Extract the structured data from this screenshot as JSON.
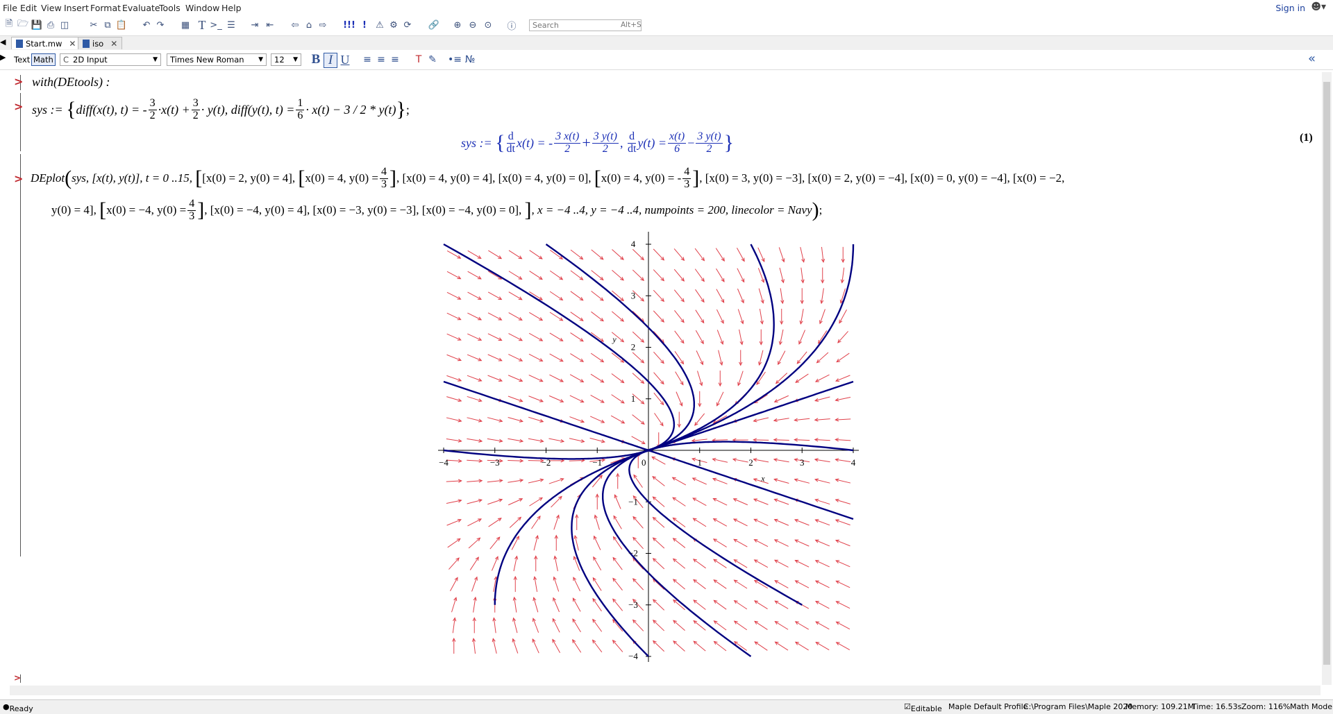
{
  "menu": [
    "File",
    "Edit",
    "View",
    "Insert",
    "Format",
    "Evaluate",
    "Tools",
    "Window",
    "Help"
  ],
  "signin": "Sign in",
  "search": {
    "placeholder": "Search",
    "hint": "Alt+S"
  },
  "tabs": [
    {
      "label": "Start.mw"
    },
    {
      "label": "iso"
    }
  ],
  "context": {
    "text_mode": "Text",
    "math_mode": "Math",
    "input_style": "2D Input",
    "font": "Times New Roman",
    "size": "12",
    "bold": "B",
    "italic": "I",
    "underline": "U"
  },
  "worksheet": {
    "line1": "with(DEtools) :",
    "line2": {
      "lhs": "sys :=",
      "part1": "diff(x(t), t) = -",
      "f1_num": "3",
      "f1_den": "2",
      "part2": "·x(t) +",
      "f2_num": "3",
      "f2_den": "2",
      "part3": "· y(t), diff(y(t), t) =",
      "f3_num": "1",
      "f3_den": "6",
      "part4": "· x(t) − 3 / 2 * y(t)",
      "end": ";"
    },
    "output": {
      "lhs": "sys :=",
      "d1_num": "d",
      "d1_den": "dt",
      "x": "x(t) = -",
      "o1_num": "3 x(t)",
      "o1_den": "2",
      "plus": "+",
      "o2_num": "3 y(t)",
      "o2_den": "2",
      "comma": ",",
      "d2_num": "d",
      "d2_den": "dt",
      "y": "y(t) =",
      "o3_num": "x(t)",
      "o3_den": "6",
      "minus": "−",
      "o4_num": "3 y(t)",
      "o4_den": "2",
      "label": "(1)"
    },
    "deplot": {
      "row1a": "DEplot",
      "row1b": "sys, [x(t), y(t)], t = 0 ..15,",
      "row1c": "[x(0) = 2, y(0) = 4],",
      "row1d": "x(0) = 4, y(0) =",
      "f1_num": "4",
      "f1_den": "3",
      "row1e": ", [x(0) = 4, y(0) = 4], [x(0) = 4, y(0) = 0],",
      "row1f": "x(0) = 4, y(0) = -",
      "f2_num": "4",
      "f2_den": "3",
      "row1g": ", [x(0) = 3, y(0) = −3], [x(0) = 2, y(0) = −4], [x(0) = 0, y(0) = −4], [x(0) = −2,",
      "row2a": "y(0) = 4],",
      "row2b": "x(0) = −4, y(0) =",
      "f3_num": "4",
      "f3_den": "3",
      "row2c": ", [x(0) = −4, y(0) = 4], [x(0) = −3, y(0) = −3], [x(0) = −4, y(0) = 0],",
      "row2d": ", x = −4 ..4, y = −4 ..4, numpoints = 200, linecolor = Navy",
      "row2e": ";"
    }
  },
  "chart_data": {
    "type": "line",
    "title": "",
    "xlabel": "x",
    "ylabel": "y",
    "xlim": [
      -4,
      4
    ],
    "ylim": [
      -4,
      4
    ],
    "xticks": [
      -4,
      -3,
      -2,
      -1,
      1,
      2,
      3,
      4
    ],
    "yticks": [
      -4,
      -3,
      -2,
      -1,
      1,
      2,
      3,
      4
    ],
    "origin_label": "0",
    "system": {
      "dx": "-3/2 x + 3/2 y",
      "dy": "1/6 x - 3/2 y"
    },
    "t_range": [
      0,
      15
    ],
    "initial_conditions": [
      [
        2,
        4
      ],
      [
        4,
        1.3333
      ],
      [
        4,
        4
      ],
      [
        4,
        0
      ],
      [
        4,
        -1.3333
      ],
      [
        3,
        -3
      ],
      [
        2,
        -4
      ],
      [
        0,
        -4
      ],
      [
        -2,
        4
      ],
      [
        -4,
        1.3333
      ],
      [
        -4,
        4
      ],
      [
        -3,
        -3
      ],
      [
        -4,
        0
      ]
    ],
    "arrow_color": "#e0404a",
    "line_color": "#000080"
  },
  "status": {
    "ready": "Ready",
    "editable": "Editable",
    "profile": "Maple Default Profile",
    "path": "C:\\Program Files\\Maple 2020",
    "memory": "Memory: 109.21M",
    "time": "Time: 16.53s",
    "zoom": "Zoom: 116%",
    "mode": "Math Mode"
  }
}
